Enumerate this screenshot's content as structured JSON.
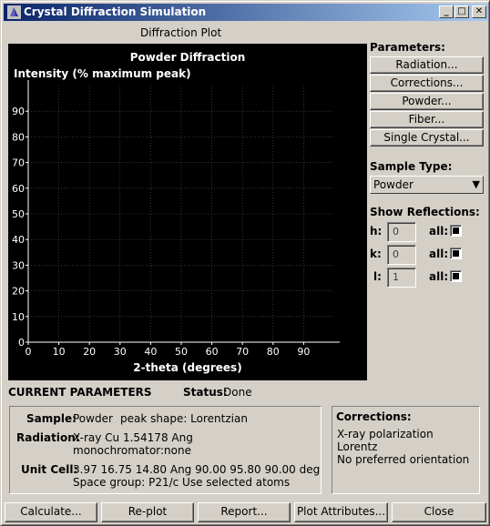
{
  "window": {
    "title": "Crystal Diffraction Simulation"
  },
  "plot_panel": {
    "heading": "Diffraction Plot"
  },
  "chart_data": {
    "type": "scatter",
    "title": "Powder Diffraction",
    "ylabel": "Intensity (% maximum peak)",
    "xlabel": "2-theta (degrees)",
    "xlim": [
      0,
      100
    ],
    "ylim": [
      0,
      100
    ],
    "xticks": [
      0,
      10,
      20,
      30,
      40,
      50,
      60,
      70,
      80,
      90
    ],
    "yticks": [
      0,
      10,
      20,
      30,
      40,
      50,
      60,
      70,
      80,
      90
    ],
    "grid": true,
    "series": []
  },
  "parameters": {
    "heading": "Parameters:",
    "buttons": [
      "Radiation...",
      "Corrections...",
      "Powder...",
      "Fiber...",
      "Single Crystal..."
    ],
    "sample_type_label": "Sample Type:",
    "sample_type_value": "Powder",
    "show_reflections_label": "Show Reflections:",
    "reflections": [
      {
        "axis": "h:",
        "value": "0",
        "all_label": "all:",
        "all_checked": true
      },
      {
        "axis": "k:",
        "value": "0",
        "all_label": "all:",
        "all_checked": true
      },
      {
        "axis": "l:",
        "value": "1",
        "all_label": "all:",
        "all_checked": true
      }
    ]
  },
  "current": {
    "heading": "CURRENT PARAMETERS",
    "status_label": "Status:",
    "status_value": "Done",
    "sample_label": "Sample:",
    "sample_value": "Powder",
    "peak_shape": "peak shape: Lorentzian",
    "radiation_label": "Radiation:",
    "radiation_line1": "X-ray Cu   1.54178 Ang",
    "radiation_line2": "monochromator:none",
    "unit_cell_label": "Unit Cell:",
    "unit_cell_line1": "3.97 16.75 14.80 Ang   90.00 95.80 90.00 deg",
    "unit_cell_line2": "Space group: P21/c    Use selected atoms"
  },
  "corrections": {
    "heading": "Corrections:",
    "items": [
      "X-ray polarization",
      "Lorentz",
      "No preferred orientation"
    ]
  },
  "bottom_buttons": {
    "calculate": "Calculate...",
    "replot": "Re-plot",
    "report": "Report...",
    "plot_attributes": "Plot Attributes...",
    "close": "Close"
  }
}
